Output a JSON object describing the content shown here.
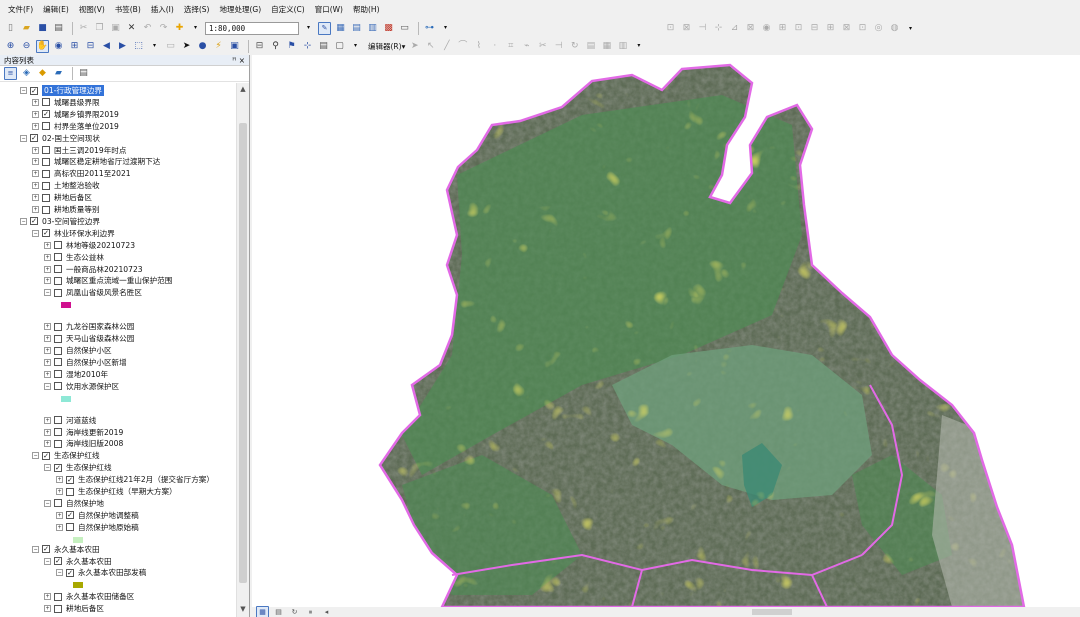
{
  "menu": [
    "文件(F)",
    "编辑(E)",
    "视图(V)",
    "书签(B)",
    "插入(I)",
    "选择(S)",
    "地理处理(G)",
    "自定义(C)",
    "窗口(W)",
    "帮助(H)"
  ],
  "toolbar": {
    "scale_value": "1:80,000",
    "editor_label": "编辑器(R)▾"
  },
  "toc": {
    "title": "内容列表",
    "pin": "ꟸ ×",
    "rows": [
      {
        "label": "01-行政管理边界",
        "level": 0,
        "expanded": true,
        "checked": true,
        "selected": true
      },
      {
        "label": "城曙县级界限",
        "level": 1,
        "expanded": false,
        "checked": false
      },
      {
        "label": "城曙乡镇界限2019",
        "level": 1,
        "expanded": false,
        "checked": true
      },
      {
        "label": "村界坐落单位2019",
        "level": 1,
        "expanded": false,
        "checked": false
      },
      {
        "label": "02-国土空间现状",
        "level": 0,
        "expanded": true,
        "checked": true
      },
      {
        "label": "国土三调2019年时点",
        "level": 1,
        "expanded": false,
        "checked": false
      },
      {
        "label": "城曙区稳定耕地省厅过渡期下达",
        "level": 1,
        "expanded": false,
        "checked": false
      },
      {
        "label": "高标农田2011至2021",
        "level": 1,
        "expanded": false,
        "checked": false
      },
      {
        "label": "土地整治验收",
        "level": 1,
        "expanded": false,
        "checked": false
      },
      {
        "label": "耕地后备区",
        "level": 1,
        "expanded": false,
        "checked": false
      },
      {
        "label": "耕地质量等别",
        "level": 1,
        "expanded": false,
        "checked": false
      },
      {
        "label": "03-空间管控边界",
        "level": 0,
        "expanded": true,
        "checked": true
      },
      {
        "label": "林业环保水利边界",
        "level": 1,
        "expanded": true,
        "checked": true
      },
      {
        "label": "林地等级20210723",
        "level": 2,
        "expanded": false,
        "checked": false
      },
      {
        "label": "生态公益林",
        "level": 2,
        "expanded": false,
        "checked": false
      },
      {
        "label": "一般商品林20210723",
        "level": 2,
        "expanded": false,
        "checked": false
      },
      {
        "label": "城曙区重点流域一重山保护范围",
        "level": 2,
        "expanded": false,
        "checked": false
      },
      {
        "label": "凤凰山省级风景名胜区",
        "level": 2,
        "expanded": true,
        "checked": false
      },
      {
        "label": "九龙谷国家森林公园",
        "level": 2,
        "expanded": false,
        "checked": false
      },
      {
        "label": "天马山省级森林公园",
        "level": 2,
        "expanded": false,
        "checked": false
      },
      {
        "label": "自然保护小区",
        "level": 2,
        "expanded": false,
        "checked": false
      },
      {
        "label": "自然保护小区新增",
        "level": 2,
        "expanded": false,
        "checked": false
      },
      {
        "label": "湿地2010年",
        "level": 2,
        "expanded": false,
        "checked": false
      },
      {
        "label": "饮用水源保护区",
        "level": 2,
        "expanded": true,
        "checked": false
      },
      {
        "label": "河道蓝线",
        "level": 2,
        "expanded": false,
        "checked": false
      },
      {
        "label": "海岸线更新2019",
        "level": 2,
        "expanded": false,
        "checked": false
      },
      {
        "label": "海岸线旧版2008",
        "level": 2,
        "expanded": false,
        "checked": false
      },
      {
        "label": "生态保护红线",
        "level": 1,
        "expanded": true,
        "checked": true
      },
      {
        "label": "生态保护红线",
        "level": 2,
        "expanded": true,
        "checked": true
      },
      {
        "label": "生态保护红线21年2月（提交省厅方案）",
        "level": 3,
        "expanded": false,
        "checked": true
      },
      {
        "label": "生态保护红线（早期大方案）",
        "level": 3,
        "expanded": false,
        "checked": false
      },
      {
        "label": "自然保护地",
        "level": 2,
        "expanded": true,
        "checked": false
      },
      {
        "label": "自然保护地调整稿",
        "level": 3,
        "expanded": false,
        "checked": true
      },
      {
        "label": "自然保护地原始稿",
        "level": 3,
        "expanded": false,
        "checked": false
      },
      {
        "label": "永久基本农田",
        "level": 1,
        "expanded": true,
        "checked": true
      },
      {
        "label": "永久基本农田",
        "level": 2,
        "expanded": true,
        "checked": true
      },
      {
        "label": "永久基本农田部发稿",
        "level": 3,
        "expanded": true,
        "checked": true
      },
      {
        "label": "永久基本农田储备区",
        "level": 2,
        "expanded": false,
        "checked": false
      },
      {
        "label": "耕地后备区",
        "level": 2,
        "expanded": false,
        "checked": false
      }
    ],
    "swatch_colors": {
      "scenic_area": "#d0108f",
      "water_source": "#8ee8d6",
      "nature_reserve": "#c6f0c0",
      "basic_farmland": "#a8a800"
    }
  },
  "map": {
    "boundary_color": "#e26ae6",
    "ecology_fill": "#4e8b54",
    "farmland_fill": "#b2b01c"
  }
}
